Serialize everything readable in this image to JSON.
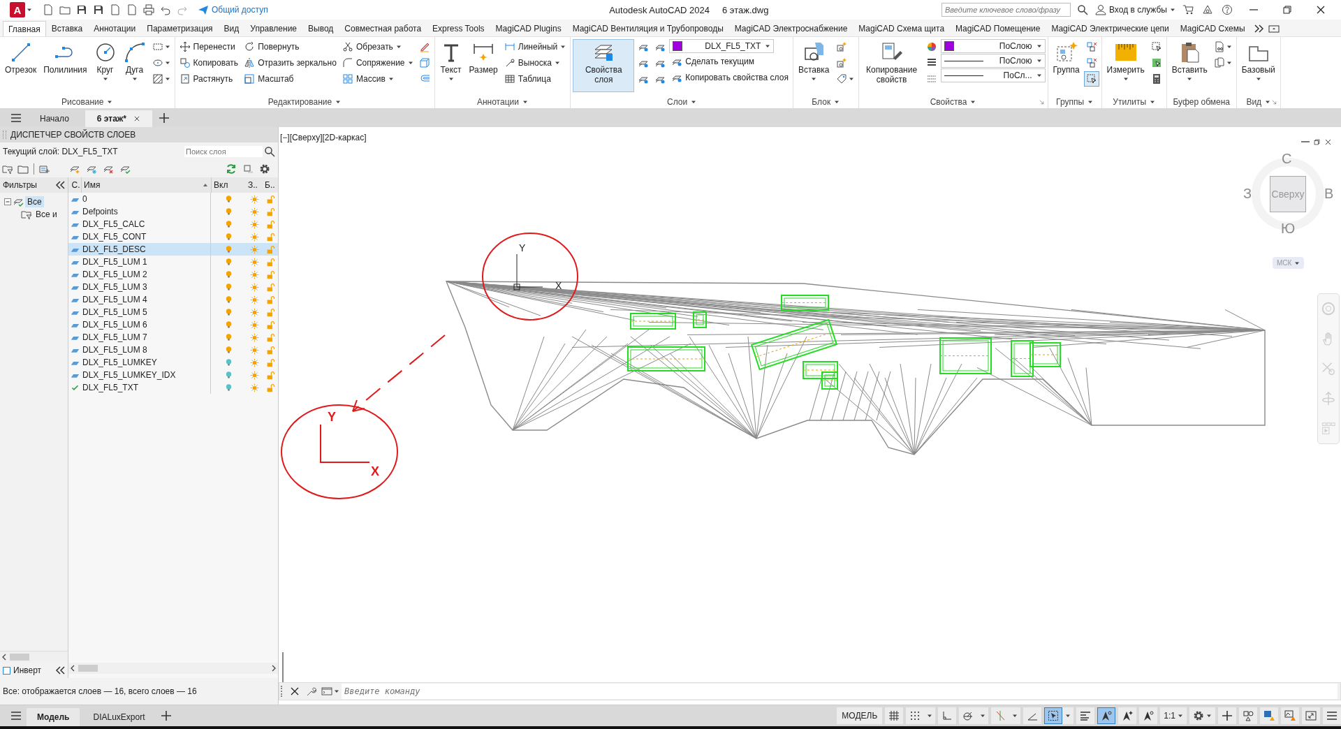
{
  "title_bar": {
    "app_logo": "A",
    "share": "Общий доступ",
    "app_title": "Autodesk AutoCAD 2024",
    "file_name": "6 этаж.dwg",
    "search": {
      "placeholder": "Введите ключевое слово/фразу"
    },
    "sign_in": "Вход в службы"
  },
  "ribbon_tabs": [
    {
      "label": "Главная",
      "selected": true
    },
    {
      "label": "Вставка",
      "selected": false
    },
    {
      "label": "Аннотации",
      "selected": false
    },
    {
      "label": "Параметризация",
      "selected": false
    },
    {
      "label": "Вид",
      "selected": false
    },
    {
      "label": "Управление",
      "selected": false
    },
    {
      "label": "Вывод",
      "selected": false
    },
    {
      "label": "Совместная работа",
      "selected": false
    },
    {
      "label": "Express Tools",
      "selected": false
    },
    {
      "label": "MagiCAD Plugins",
      "selected": false
    },
    {
      "label": "MagiCAD Вентиляция и Трубопроводы",
      "selected": false
    },
    {
      "label": "MagiCAD Электроснабжение",
      "selected": false
    },
    {
      "label": "MagiCAD Схема щита",
      "selected": false
    },
    {
      "label": "MagiCAD Помещение",
      "selected": false
    },
    {
      "label": "MagiCAD Электрические цепи",
      "selected": false
    },
    {
      "label": "MagiCAD Схемы",
      "selected": false
    }
  ],
  "ribbon_panels": [
    {
      "title": "Рисование",
      "dropdown": true,
      "launcher": false,
      "columns": [
        [
          {
            "kind": "large",
            "label": "Отрезок",
            "dropdown": false,
            "active": false
          }
        ],
        [
          {
            "kind": "large",
            "label": "Полилиния",
            "dropdown": false,
            "active": false
          }
        ],
        [
          {
            "kind": "large",
            "label": "Круг",
            "dropdown": true,
            "active": false
          }
        ],
        [
          {
            "kind": "large",
            "label": "Дуга",
            "dropdown": true,
            "active": false
          }
        ],
        [
          {
            "kind": "icon",
            "dropdown": true,
            "active": false
          },
          {
            "kind": "icon",
            "dropdown": true,
            "active": false
          },
          {
            "kind": "icon",
            "dropdown": true,
            "active": false
          }
        ]
      ]
    },
    {
      "title": "Редактирование",
      "dropdown": true,
      "launcher": false,
      "columns": [
        [
          {
            "kind": "small",
            "label": "Перенести",
            "dropdown": false
          },
          {
            "kind": "small",
            "label": "Копировать",
            "dropdown": false
          },
          {
            "kind": "small",
            "label": "Растянуть",
            "dropdown": false
          }
        ],
        [
          {
            "kind": "small",
            "label": "Повернуть",
            "dropdown": false
          },
          {
            "kind": "small",
            "label": "Отразить зеркально",
            "dropdown": false
          },
          {
            "kind": "small",
            "label": "Масштаб",
            "dropdown": false
          }
        ],
        [
          {
            "kind": "small",
            "label": "Обрезать",
            "dropdown": true
          },
          {
            "kind": "small",
            "label": "Сопряжение",
            "dropdown": true
          },
          {
            "kind": "small",
            "label": "Массив",
            "dropdown": true
          }
        ],
        [
          {
            "kind": "icon",
            "dropdown": false,
            "active": false
          },
          {
            "kind": "icon",
            "dropdown": false,
            "active": false
          },
          {
            "kind": "icon",
            "dropdown": false,
            "active": false
          }
        ]
      ]
    },
    {
      "title": "Аннотации",
      "dropdown": true,
      "launcher": false,
      "columns": [
        [
          {
            "kind": "large",
            "label": "Текст",
            "dropdown": true,
            "active": false
          }
        ],
        [
          {
            "kind": "large",
            "label": "Размер",
            "dropdown": false,
            "active": false
          }
        ],
        [
          {
            "kind": "small",
            "label": "Линейный",
            "dropdown": true
          },
          {
            "kind": "small",
            "label": "Выноска",
            "dropdown": true
          },
          {
            "kind": "small",
            "label": "Таблица",
            "dropdown": false
          }
        ]
      ]
    },
    {
      "title": "Слои",
      "dropdown": true,
      "launcher": false,
      "columns": [
        [
          {
            "kind": "large",
            "label": "Свойства слоя",
            "dropdown": false,
            "active": true
          }
        ],
        [
          {
            "kind": "icon",
            "dropdown": false,
            "active": false
          },
          {
            "kind": "icon",
            "dropdown": false,
            "active": false
          },
          {
            "kind": "icon",
            "dropdown": false,
            "active": false
          }
        ],
        [
          {
            "kind": "icon",
            "dropdown": false,
            "active": false
          },
          {
            "kind": "icon",
            "dropdown": false,
            "active": false
          },
          {
            "kind": "icon",
            "dropdown": false,
            "active": false
          }
        ],
        [
          {
            "kind": "combo",
            "value": "DLX_FL5_TXT",
            "color": "#a000e0"
          },
          {
            "kind": "small",
            "label": "Сделать текущим",
            "dropdown": false
          },
          {
            "kind": "small",
            "label": "Копировать свойства слоя",
            "dropdown": false
          }
        ]
      ]
    },
    {
      "title": "Блок",
      "dropdown": true,
      "launcher": false,
      "columns": [
        [
          {
            "kind": "large",
            "label": "Вставка",
            "dropdown": true,
            "active": false
          }
        ],
        [
          {
            "kind": "icon",
            "dropdown": false,
            "active": false
          },
          {
            "kind": "icon",
            "dropdown": false,
            "active": false
          },
          {
            "kind": "icon",
            "dropdown": true,
            "active": false
          }
        ]
      ]
    },
    {
      "title": "Свойства",
      "dropdown": true,
      "launcher": true,
      "columns": [
        [
          {
            "kind": "large",
            "label": "Копирование свойств",
            "dropdown": false,
            "active": false
          }
        ],
        [
          {
            "kind": "icon",
            "dropdown": false,
            "active": false
          },
          {
            "kind": "icon",
            "dropdown": false,
            "active": false
          },
          {
            "kind": "icon",
            "dropdown": false,
            "active": false
          }
        ],
        [
          {
            "kind": "combo",
            "value": "ПоСлою",
            "color": "#a000e0"
          },
          {
            "kind": "line-combo",
            "value": "ПоСлою"
          },
          {
            "kind": "line-combo",
            "value": "ПоСл..."
          }
        ]
      ]
    },
    {
      "title": "Группы",
      "dropdown": true,
      "launcher": false,
      "columns": [
        [
          {
            "kind": "large",
            "label": "Группа",
            "dropdown": false,
            "active": false
          }
        ],
        [
          {
            "kind": "icon",
            "dropdown": false,
            "active": false
          },
          {
            "kind": "icon",
            "dropdown": false,
            "active": false
          },
          {
            "kind": "icon",
            "dropdown": false,
            "active": true
          }
        ]
      ]
    },
    {
      "title": "Утилиты",
      "dropdown": true,
      "launcher": false,
      "columns": [
        [
          {
            "kind": "large",
            "label": "Измерить",
            "dropdown": true,
            "active": false
          }
        ],
        [
          {
            "kind": "icon",
            "dropdown": false,
            "active": false
          },
          {
            "kind": "icon",
            "dropdown": false,
            "active": false
          },
          {
            "kind": "icon",
            "dropdown": false,
            "active": false
          }
        ]
      ]
    },
    {
      "title": "Буфер обмена",
      "dropdown": false,
      "launcher": false,
      "columns": [
        [
          {
            "kind": "large",
            "label": "Вставить",
            "dropdown": true,
            "active": false
          }
        ],
        [
          {
            "kind": "icon",
            "dropdown": true,
            "active": false
          },
          {
            "kind": "icon",
            "dropdown": true,
            "active": false
          }
        ]
      ]
    },
    {
      "title": "Вид",
      "dropdown": true,
      "launcher": true,
      "columns": [
        [
          {
            "kind": "large",
            "label": "Базовый",
            "dropdown": true,
            "active": false
          }
        ]
      ]
    }
  ],
  "file_tabs": [
    {
      "label": "Начало",
      "selected": false,
      "closable": false
    },
    {
      "label": "6 этаж*",
      "selected": true,
      "closable": true
    }
  ],
  "layer_palette": {
    "title": "ДИСПЕТЧЕР СВОЙСТВ СЛОЕВ",
    "current_layer": "Текущий слой: DLX_FL5_TXT",
    "search": {
      "placeholder": "Поиск слоя"
    },
    "filters_title": "Фильтры",
    "filter_tree": [
      {
        "label": "Все",
        "selected": true,
        "expanded": true,
        "children": [
          {
            "label": "Все и",
            "selected": false
          }
        ]
      }
    ],
    "columns": [
      "С.",
      "Имя",
      "Вкл",
      "З..",
      "Б.."
    ],
    "rows": [
      {
        "name": "0",
        "current": false,
        "selected": false,
        "on": true,
        "color": "#f5a300",
        "frozen": false,
        "locked": false
      },
      {
        "name": "Defpoints",
        "current": false,
        "selected": false,
        "on": true,
        "color": "#f5a300",
        "frozen": false,
        "locked": false
      },
      {
        "name": "DLX_FL5_CALC",
        "current": false,
        "selected": false,
        "on": true,
        "color": "#f5a300",
        "frozen": false,
        "locked": false
      },
      {
        "name": "DLX_FL5_CONT",
        "current": false,
        "selected": false,
        "on": true,
        "color": "#f5a300",
        "frozen": false,
        "locked": false
      },
      {
        "name": "DLX_FL5_DESC",
        "current": false,
        "selected": true,
        "on": true,
        "color": "#f5a300",
        "frozen": false,
        "locked": false
      },
      {
        "name": "DLX_FL5_LUM 1",
        "current": false,
        "selected": false,
        "on": true,
        "color": "#f5a300",
        "frozen": false,
        "locked": false
      },
      {
        "name": "DLX_FL5_LUM 2",
        "current": false,
        "selected": false,
        "on": true,
        "color": "#f5a300",
        "frozen": false,
        "locked": false
      },
      {
        "name": "DLX_FL5_LUM 3",
        "current": false,
        "selected": false,
        "on": true,
        "color": "#f5a300",
        "frozen": false,
        "locked": false
      },
      {
        "name": "DLX_FL5_LUM 4",
        "current": false,
        "selected": false,
        "on": true,
        "color": "#f5a300",
        "frozen": false,
        "locked": false
      },
      {
        "name": "DLX_FL5_LUM 5",
        "current": false,
        "selected": false,
        "on": true,
        "color": "#f5a300",
        "frozen": false,
        "locked": false
      },
      {
        "name": "DLX_FL5_LUM 6",
        "current": false,
        "selected": false,
        "on": true,
        "color": "#f5a300",
        "frozen": false,
        "locked": false
      },
      {
        "name": "DLX_FL5_LUM 7",
        "current": false,
        "selected": false,
        "on": true,
        "color": "#f5a300",
        "frozen": false,
        "locked": false
      },
      {
        "name": "DLX_FL5_LUM 8",
        "current": false,
        "selected": false,
        "on": true,
        "color": "#f5a300",
        "frozen": false,
        "locked": false
      },
      {
        "name": "DLX_FL5_LUMKEY",
        "current": false,
        "selected": false,
        "on": true,
        "color": "#5bc0c8",
        "frozen": false,
        "locked": false
      },
      {
        "name": "DLX_FL5_LUMKEY_IDX",
        "current": false,
        "selected": false,
        "on": true,
        "color": "#5bc0c8",
        "frozen": false,
        "locked": false
      },
      {
        "name": "DLX_FL5_TXT",
        "current": true,
        "selected": false,
        "on": true,
        "color": "#5bc0c8",
        "frozen": false,
        "locked": false
      }
    ],
    "invert": {
      "label": "Инверт",
      "checked": false
    },
    "status": "Все: отображается слоев — 16, всего слоев — 16"
  },
  "viewport": {
    "label": "[−][Сверху][2D-каркас]",
    "ucs_labels": [
      "Y",
      "X"
    ],
    "sketch_labels": [
      "Y",
      "X"
    ],
    "viewcube": {
      "north": "С",
      "west": "З",
      "east": "В",
      "south": "Ю",
      "face": "Сверху",
      "ucs": "МСК"
    }
  },
  "command_line": {
    "placeholder": "Введите команду"
  },
  "layout_tabs": [
    {
      "label": "Модель",
      "selected": true
    },
    {
      "label": "DIALuxExport",
      "selected": false
    }
  ],
  "status_bar": {
    "mode": "МОДЕЛЬ",
    "scale": "1:1",
    "toggles": [
      {
        "on": false,
        "dropdown": false
      },
      {
        "on": false,
        "dropdown": true
      },
      {
        "on": false,
        "dropdown": false
      },
      {
        "on": false,
        "dropdown": true
      },
      {
        "on": false,
        "dropdown": true
      },
      {
        "on": false,
        "dropdown": false
      },
      {
        "on": true,
        "dropdown": true
      },
      {
        "on": false,
        "dropdown": false
      },
      {
        "on": true,
        "dropdown": false
      },
      {
        "on": false,
        "dropdown": false
      },
      {
        "on": false,
        "dropdown": false
      }
    ]
  }
}
